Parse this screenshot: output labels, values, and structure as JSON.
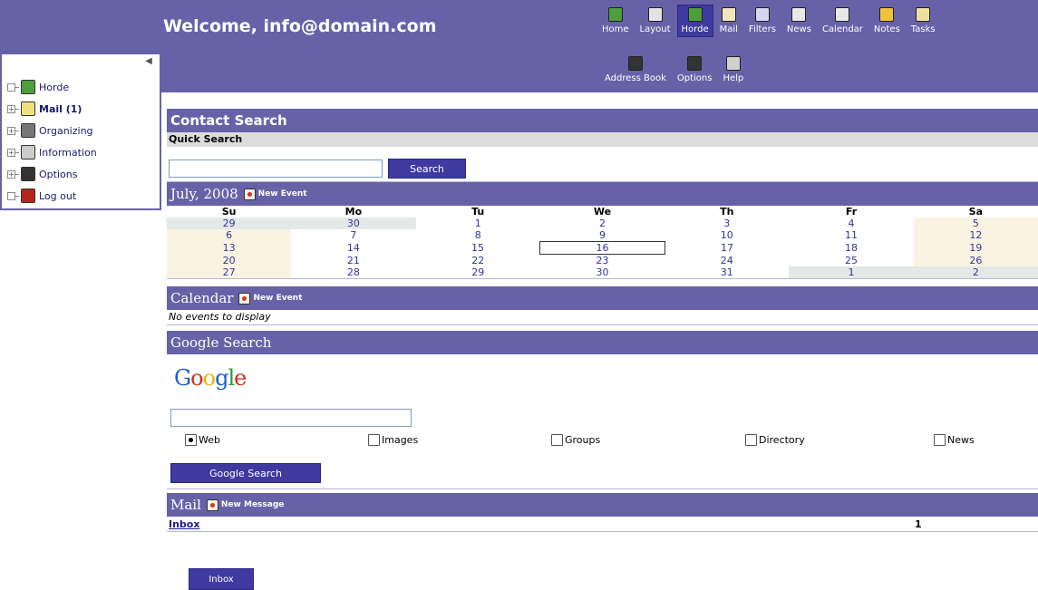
{
  "header": {
    "welcome": "Welcome, info@domain.com",
    "nav_primary": [
      {
        "label": "Home",
        "icon": "home-icon",
        "color": "#4f9e3c"
      },
      {
        "label": "Layout",
        "icon": "layout-icon",
        "color": "#e3e3e3"
      },
      {
        "label": "Horde",
        "icon": "horde-icon",
        "color": "#4f9e3c"
      },
      {
        "label": "Mail",
        "icon": "mail-icon",
        "color": "#f2e6c0"
      },
      {
        "label": "Filters",
        "icon": "filter-icon",
        "color": "#d6d6f0"
      },
      {
        "label": "News",
        "icon": "news-icon",
        "color": "#e8e8e8"
      },
      {
        "label": "Calendar",
        "icon": "calendar-icon",
        "color": "#e8e8e8"
      },
      {
        "label": "Notes",
        "icon": "notes-icon",
        "color": "#f0c43a"
      },
      {
        "label": "Tasks",
        "icon": "tasks-icon",
        "color": "#f0e0a0"
      }
    ],
    "nav_secondary": [
      {
        "label": "Address Book",
        "icon": "address-book-icon",
        "color": "#333333"
      },
      {
        "label": "Options",
        "icon": "options-icon",
        "color": "#333333"
      },
      {
        "label": "Help",
        "icon": "help-icon",
        "color": "#d0d0d0"
      }
    ]
  },
  "sidebar": {
    "items": [
      {
        "label": "Horde",
        "toggle": "−",
        "icon": "horde-icon",
        "color": "#4f9e3c",
        "bold": false
      },
      {
        "label": "Mail (1)",
        "toggle": "+",
        "icon": "mail-folder-icon",
        "color": "#f0e080",
        "bold": true
      },
      {
        "label": "Organizing",
        "toggle": "+",
        "icon": "organizing-icon",
        "color": "#777777",
        "bold": false
      },
      {
        "label": "Information",
        "toggle": "+",
        "icon": "information-icon",
        "color": "#cccccc",
        "bold": false
      },
      {
        "label": "Options",
        "toggle": "+",
        "icon": "options-icon",
        "color": "#333333",
        "bold": false
      },
      {
        "label": "Log out",
        "toggle": "−",
        "icon": "logout-icon",
        "color": "#b3261e",
        "bold": false
      }
    ]
  },
  "contact_search": {
    "title": "Contact Search",
    "quick_search_label": "Quick Search",
    "input_value": "",
    "button_label": "Search"
  },
  "month_calendar": {
    "title": "July, 2008",
    "new_event_label": "New Event",
    "weekdays": [
      "Su",
      "Mo",
      "Tu",
      "We",
      "Th",
      "Fr",
      "Sa"
    ],
    "weeks": [
      [
        {
          "d": "29",
          "t": "other"
        },
        {
          "d": "30",
          "t": "other"
        },
        {
          "d": "1",
          "t": ""
        },
        {
          "d": "2",
          "t": ""
        },
        {
          "d": "3",
          "t": ""
        },
        {
          "d": "4",
          "t": ""
        },
        {
          "d": "5",
          "t": "weekend"
        }
      ],
      [
        {
          "d": "6",
          "t": "weekend"
        },
        {
          "d": "7",
          "t": ""
        },
        {
          "d": "8",
          "t": ""
        },
        {
          "d": "9",
          "t": ""
        },
        {
          "d": "10",
          "t": ""
        },
        {
          "d": "11",
          "t": ""
        },
        {
          "d": "12",
          "t": "weekend"
        }
      ],
      [
        {
          "d": "13",
          "t": "weekend"
        },
        {
          "d": "14",
          "t": ""
        },
        {
          "d": "15",
          "t": ""
        },
        {
          "d": "16",
          "t": "today"
        },
        {
          "d": "17",
          "t": ""
        },
        {
          "d": "18",
          "t": ""
        },
        {
          "d": "19",
          "t": "weekend"
        }
      ],
      [
        {
          "d": "20",
          "t": "weekend"
        },
        {
          "d": "21",
          "t": ""
        },
        {
          "d": "22",
          "t": ""
        },
        {
          "d": "23",
          "t": ""
        },
        {
          "d": "24",
          "t": ""
        },
        {
          "d": "25",
          "t": ""
        },
        {
          "d": "26",
          "t": "weekend"
        }
      ],
      [
        {
          "d": "27",
          "t": "weekend"
        },
        {
          "d": "28",
          "t": ""
        },
        {
          "d": "29",
          "t": ""
        },
        {
          "d": "30",
          "t": ""
        },
        {
          "d": "31",
          "t": ""
        },
        {
          "d": "1",
          "t": "other"
        },
        {
          "d": "2",
          "t": "other"
        }
      ]
    ]
  },
  "calendar_block": {
    "title": "Calendar",
    "new_event_label": "New Event",
    "empty_message": "No events to display"
  },
  "google_search": {
    "title": "Google Search",
    "logo_text": "Google",
    "options": [
      {
        "label": "Web",
        "checked": true
      },
      {
        "label": "Images",
        "checked": false
      },
      {
        "label": "Groups",
        "checked": false
      },
      {
        "label": "Directory",
        "checked": false
      },
      {
        "label": "News",
        "checked": false
      }
    ],
    "button_label": "Google Search"
  },
  "mail_block": {
    "title": "Mail",
    "new_message_label": "New Message",
    "inbox_link": "Inbox",
    "inbox_count": "1",
    "inbox_button": "Inbox"
  }
}
